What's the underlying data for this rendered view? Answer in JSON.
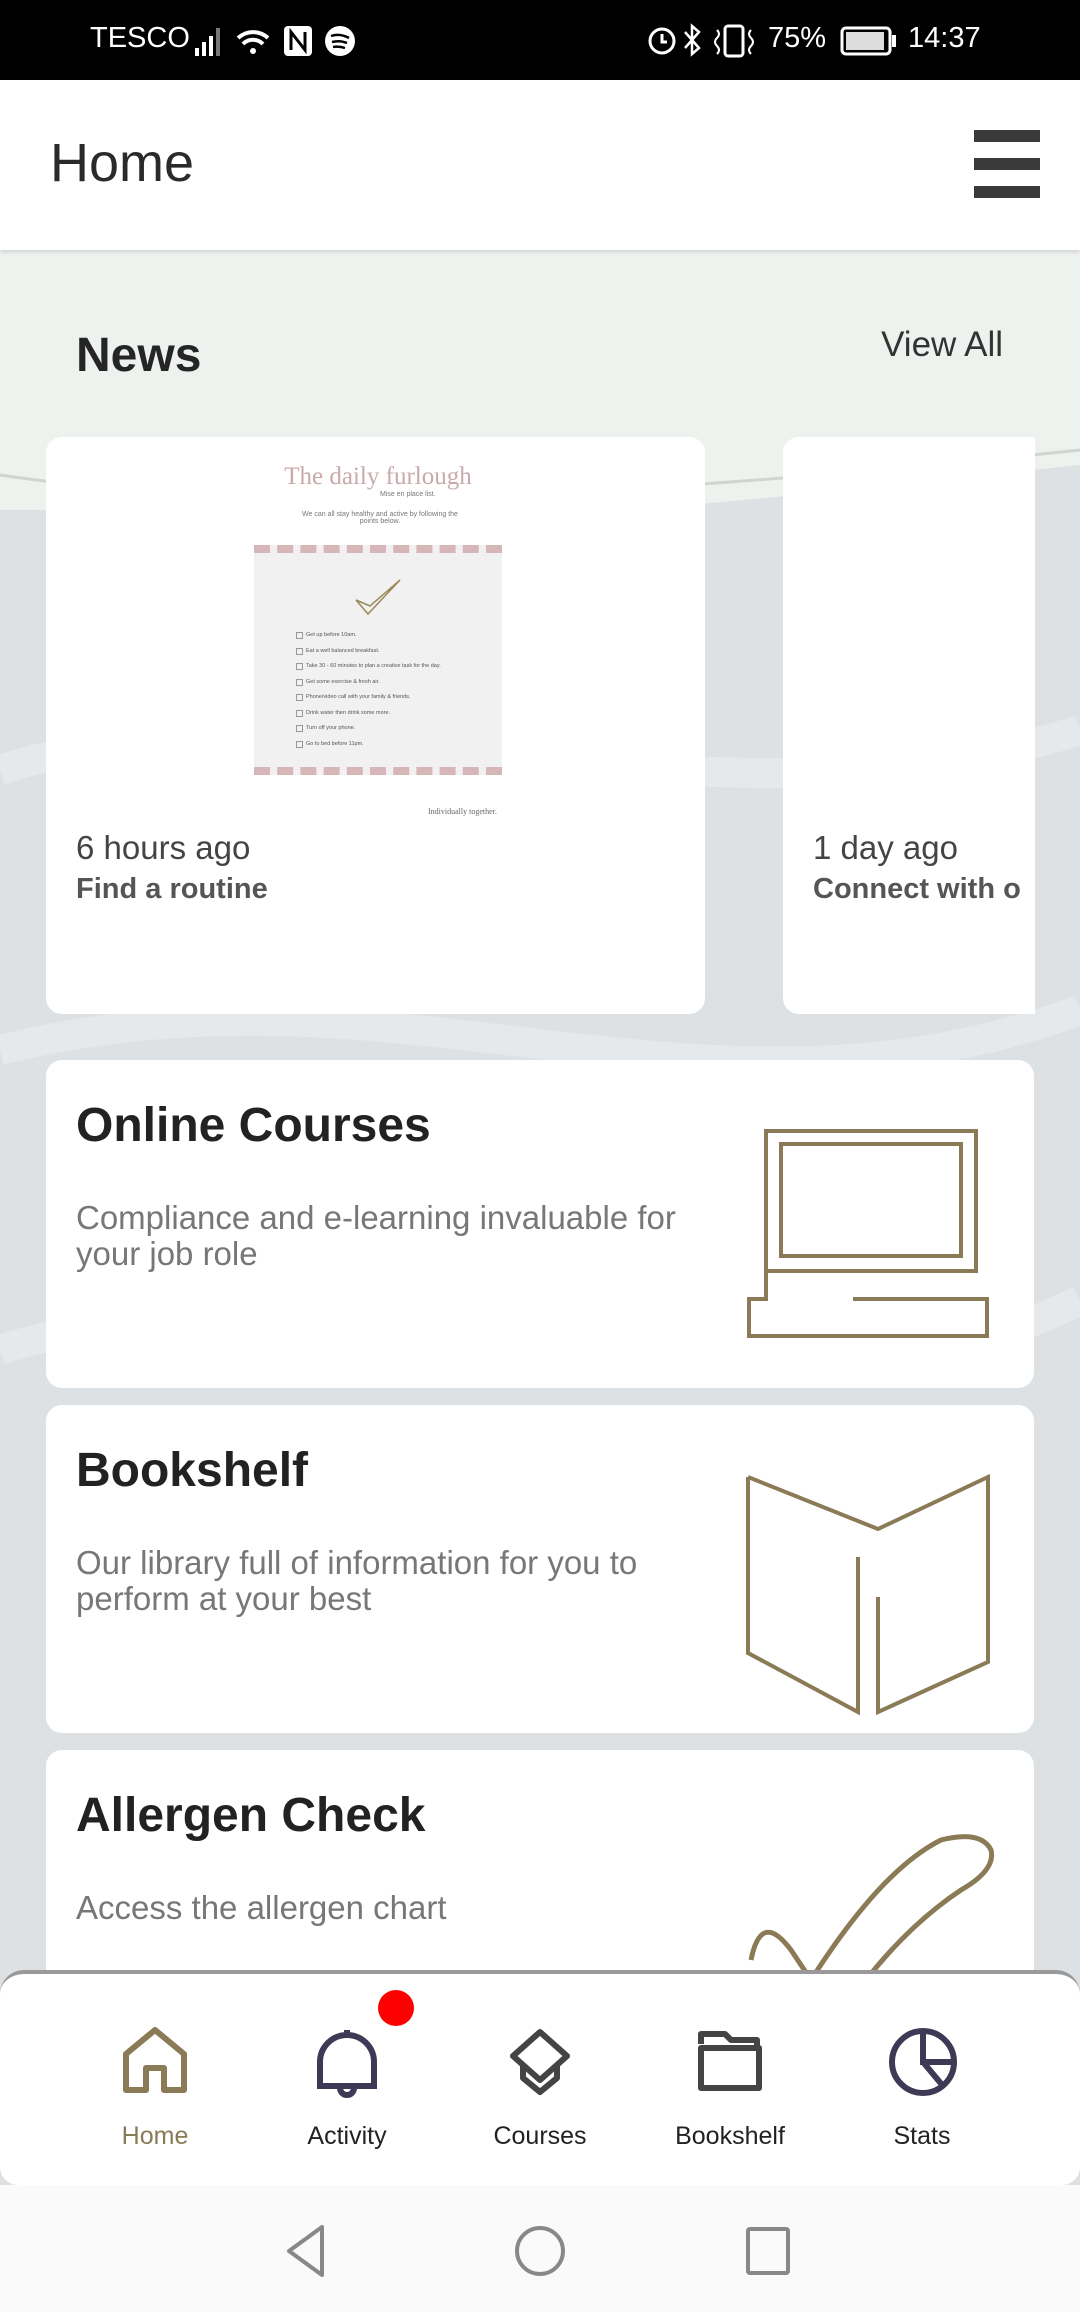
{
  "status_bar": {
    "carrier": "TESCO",
    "battery": "75%",
    "time": "14:37"
  },
  "header": {
    "title": "Home",
    "menu_icon": "hamburger-icon"
  },
  "news": {
    "title": "News",
    "view_all": "View All",
    "items": [
      {
        "time": "6 hours ago",
        "title": "Find a routine",
        "image": {
          "heading": "The daily furlough",
          "subheading": "Mise en place list.",
          "intro": "We can all stay healthy and active by following the points below.",
          "checklist": [
            "Get up before 10am.",
            "Eat a well balanced breakfast.",
            "Take 30 - 60 minutes to plan a creative task for the day.",
            "Get some exercise & fresh air.",
            "Phone/video call with your family & friends.",
            "Drink water then drink some more.",
            "Turn off your phone.",
            "Go to bed before 11pm."
          ],
          "footer": "Individually together."
        }
      },
      {
        "time": "1 day ago",
        "title": "Connect with o"
      }
    ]
  },
  "cards": [
    {
      "title": "Online Courses",
      "description": "Compliance and e-learning invaluable for your job role",
      "icon": "computer-icon"
    },
    {
      "title": "Bookshelf",
      "description": "Our library full of information for you to perform at your best",
      "icon": "book-icon"
    },
    {
      "title": "Allergen Check",
      "description": "Access the allergen chart",
      "icon": "checkmark-icon"
    }
  ],
  "bottom_nav": [
    {
      "label": "Home",
      "icon": "home-icon",
      "active": true
    },
    {
      "label": "Activity",
      "icon": "bell-icon",
      "badge": true
    },
    {
      "label": "Courses",
      "icon": "graduation-cap-icon"
    },
    {
      "label": "Bookshelf",
      "icon": "folder-icon"
    },
    {
      "label": "Stats",
      "icon": "pie-chart-icon"
    }
  ],
  "colors": {
    "accent": "#8a7a55",
    "badge": "#ff0000",
    "text": "#222222"
  }
}
